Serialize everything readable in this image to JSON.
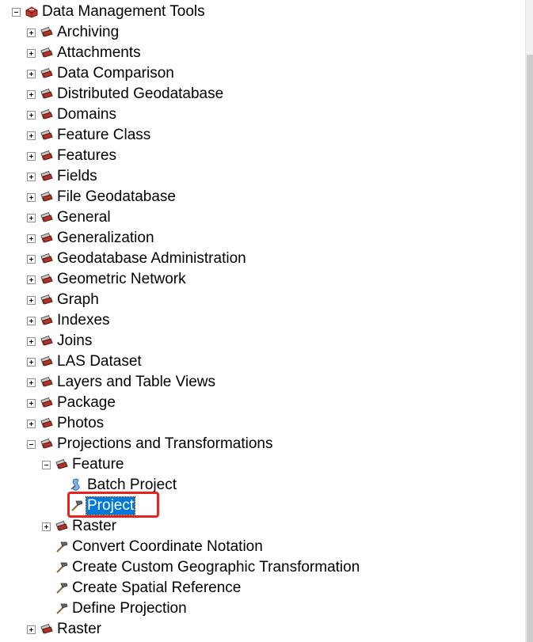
{
  "tree": {
    "root": {
      "label": "Data Management Tools",
      "icon": "toolbox-icon",
      "expanded": true
    },
    "items": [
      {
        "label": "Archiving",
        "icon": "toolset-icon",
        "expanded": false
      },
      {
        "label": "Attachments",
        "icon": "toolset-icon",
        "expanded": false
      },
      {
        "label": "Data Comparison",
        "icon": "toolset-icon",
        "expanded": false
      },
      {
        "label": "Distributed Geodatabase",
        "icon": "toolset-icon",
        "expanded": false
      },
      {
        "label": "Domains",
        "icon": "toolset-icon",
        "expanded": false
      },
      {
        "label": "Feature Class",
        "icon": "toolset-icon",
        "expanded": false
      },
      {
        "label": "Features",
        "icon": "toolset-icon",
        "expanded": false
      },
      {
        "label": "Fields",
        "icon": "toolset-icon",
        "expanded": false
      },
      {
        "label": "File Geodatabase",
        "icon": "toolset-icon",
        "expanded": false
      },
      {
        "label": "General",
        "icon": "toolset-icon",
        "expanded": false
      },
      {
        "label": "Generalization",
        "icon": "toolset-icon",
        "expanded": false
      },
      {
        "label": "Geodatabase Administration",
        "icon": "toolset-icon",
        "expanded": false
      },
      {
        "label": "Geometric Network",
        "icon": "toolset-icon",
        "expanded": false
      },
      {
        "label": "Graph",
        "icon": "toolset-icon",
        "expanded": false
      },
      {
        "label": "Indexes",
        "icon": "toolset-icon",
        "expanded": false
      },
      {
        "label": "Joins",
        "icon": "toolset-icon",
        "expanded": false
      },
      {
        "label": "LAS Dataset",
        "icon": "toolset-icon",
        "expanded": false
      },
      {
        "label": "Layers and Table Views",
        "icon": "toolset-icon",
        "expanded": false
      },
      {
        "label": "Package",
        "icon": "toolset-icon",
        "expanded": false
      },
      {
        "label": "Photos",
        "icon": "toolset-icon",
        "expanded": false
      },
      {
        "label": "Projections and Transformations",
        "icon": "toolset-icon",
        "expanded": true
      }
    ],
    "projections": {
      "feature": {
        "label": "Feature",
        "icon": "toolset-icon",
        "expanded": true
      },
      "batch_project": {
        "label": "Batch Project",
        "icon": "script-tool-icon"
      },
      "project": {
        "label": "Project",
        "icon": "hammer-tool-icon",
        "selected": true
      },
      "raster": {
        "label": "Raster",
        "icon": "toolset-icon",
        "expanded": false
      },
      "tools": [
        {
          "label": "Convert Coordinate Notation",
          "icon": "hammer-tool-icon"
        },
        {
          "label": "Create Custom Geographic Transformation",
          "icon": "hammer-tool-icon"
        },
        {
          "label": "Create Spatial Reference",
          "icon": "hammer-tool-icon"
        },
        {
          "label": "Define Projection",
          "icon": "hammer-tool-icon"
        }
      ]
    },
    "after": {
      "label": "Raster",
      "icon": "toolset-icon",
      "expanded": false
    }
  },
  "colors": {
    "selection": "#0078d7",
    "highlight_box": "#e8231e"
  }
}
